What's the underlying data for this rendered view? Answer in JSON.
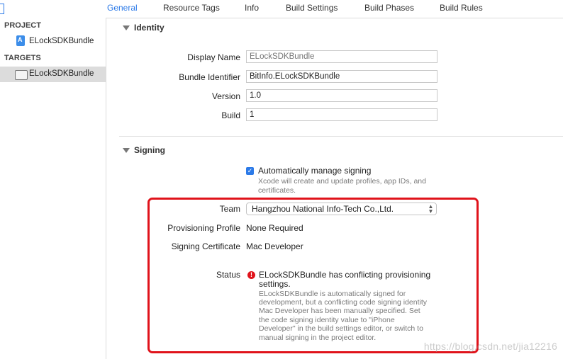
{
  "tabs": [
    "General",
    "Resource Tags",
    "Info",
    "Build Settings",
    "Build Phases",
    "Build Rules"
  ],
  "sidebar": {
    "project_heading": "PROJECT",
    "project_item": "ELockSDKBundle",
    "targets_heading": "TARGETS",
    "target_item": "ELockSDKBundle"
  },
  "identity": {
    "title": "Identity",
    "display_name_label": "Display Name",
    "display_name_placeholder": "ELockSDKBundle",
    "bundle_identifier_label": "Bundle Identifier",
    "bundle_identifier_value": "BitInfo.ELockSDKBundle",
    "version_label": "Version",
    "version_value": "1.0",
    "build_label": "Build",
    "build_value": "1"
  },
  "signing": {
    "title": "Signing",
    "auto_manage_label": "Automatically manage signing",
    "auto_manage_checked": true,
    "auto_manage_hint_1": "Xcode will create and update profiles, app IDs, and",
    "auto_manage_hint_2": "certificates.",
    "team_label": "Team",
    "team_value": "Hangzhou National Info-Tech Co.,Ltd.",
    "provisioning_label": "Provisioning Profile",
    "provisioning_value": "None Required",
    "certificate_label": "Signing Certificate",
    "certificate_value": "Mac Developer",
    "status_label": "Status",
    "status_title_1": "ELockSDKBundle has conflicting provisioning",
    "status_title_2": "settings.",
    "status_desc": [
      "ELockSDKBundle is automatically signed for",
      "development, but a conflicting code signing identity",
      "Mac Developer has been manually specified. Set",
      "the code signing identity value to \"iPhone",
      "Developer\" in the build settings editor, or switch to",
      "manual signing in the project editor."
    ]
  },
  "watermark": "https://blog.csdn.net/jia12216",
  "colors": {
    "accent": "#2c7ae8",
    "error": "#e0131b"
  }
}
